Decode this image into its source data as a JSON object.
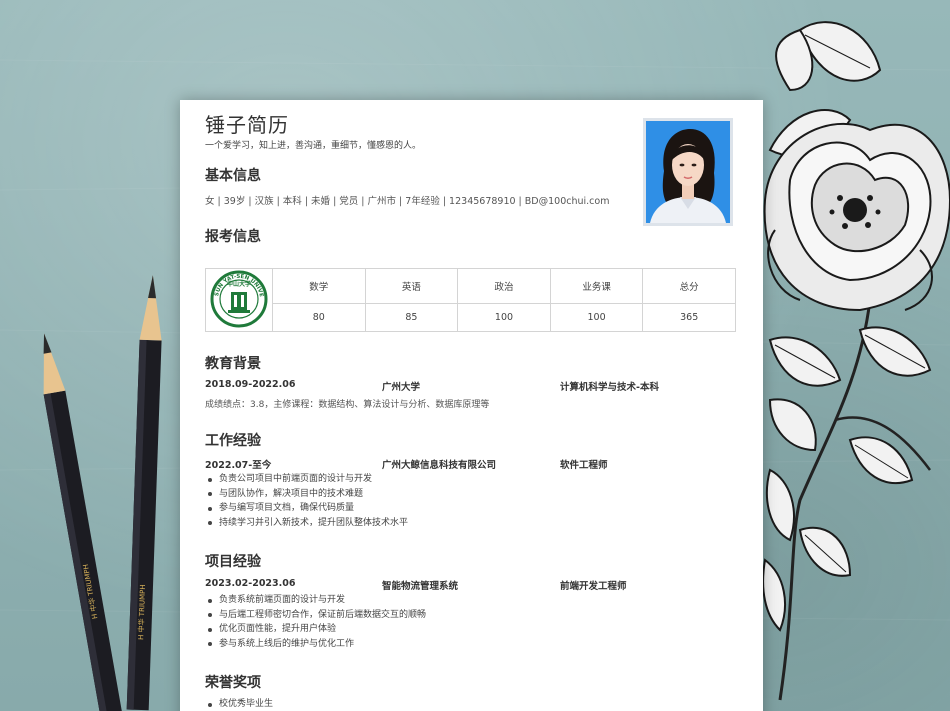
{
  "resume": {
    "name": "锤子简历",
    "slogan": "一个爱学习，知上进，善沟通，重细节，懂感恩的人。",
    "sections": {
      "basic": "基本信息",
      "exam": "报考信息",
      "education": "教育背景",
      "work": "工作经验",
      "project": "项目经验",
      "honors": "荣誉奖项"
    },
    "basic_info": "女 | 39岁 | 汉族 | 本科 | 未婚 | 党员 | 广州市 | 7年经验 | 12345678910 | BD@100chui.com",
    "exam_table": {
      "headers": [
        "数学",
        "英语",
        "政治",
        "业务课",
        "总分"
      ],
      "values": [
        "80",
        "85",
        "100",
        "100",
        "365"
      ],
      "logo_top_text": "中山大学",
      "logo_ring_text": "SUN YAT-SEN UNIVERSITY"
    },
    "education": {
      "period": "2018.09-2022.06",
      "school": "广州大学",
      "major": "计算机科学与技术-本科",
      "detail": "成绩绩点：3.8，主修课程：数据结构、算法设计与分析、数据库原理等"
    },
    "work": {
      "period": "2022.07-至今",
      "company": "广州大鲸信息科技有限公司",
      "role": "软件工程师",
      "items": [
        "负责公司项目中前端页面的设计与开发",
        "与团队协作，解决项目中的技术难题",
        "参与编写项目文档，确保代码质量",
        "持续学习并引入新技术，提升团队整体技术水平"
      ]
    },
    "project": {
      "period": "2023.02-2023.06",
      "name": "智能物流管理系统",
      "role": "前端开发工程师",
      "items": [
        "负责系统前端页面的设计与开发",
        "与后端工程师密切合作，保证前后端数据交互的顺畅",
        "优化页面性能，提升用户体验",
        "参与系统上线后的维护与优化工作"
      ]
    },
    "honors": {
      "items": [
        "校优秀毕业生"
      ]
    }
  },
  "pencils": {
    "left_text": "H 中华 TRIUMPH",
    "right_text": "H 中华 TRIUMPH"
  },
  "colors": {
    "background": "#8fb0b1",
    "paper": "#ffffff",
    "logo_green": "#1f7a3a",
    "photo_bg": "#2f8fe6"
  }
}
